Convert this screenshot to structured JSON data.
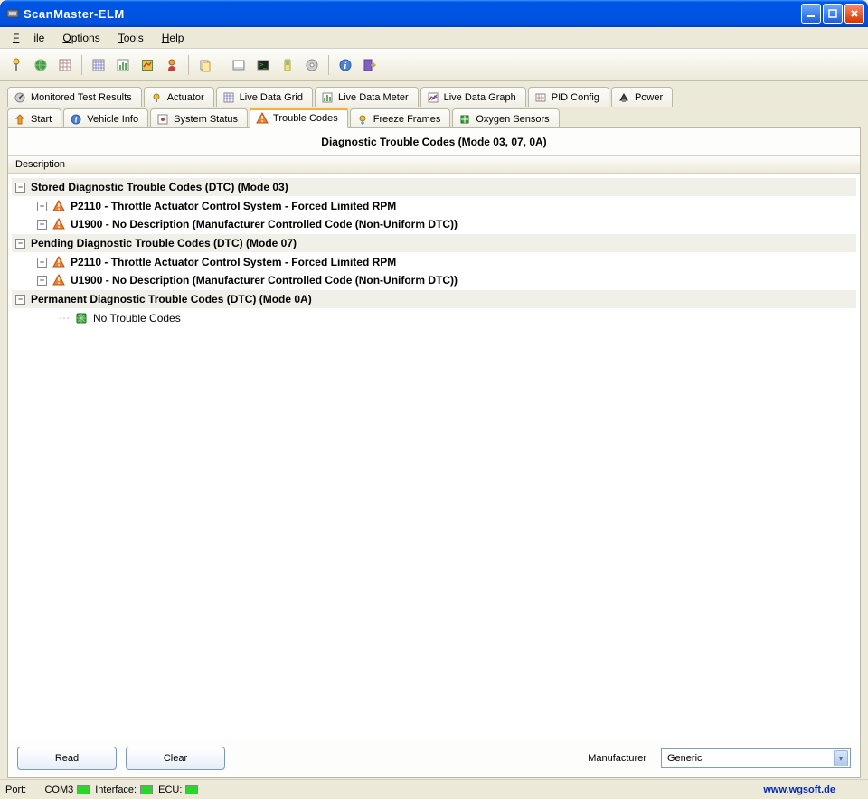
{
  "window": {
    "title": "ScanMaster-ELM"
  },
  "menu": {
    "file": "File",
    "options": "Options",
    "tools": "Tools",
    "help": "Help"
  },
  "tabs_top": [
    {
      "label": "Monitored Test Results",
      "icon": "gauge"
    },
    {
      "label": "Actuator",
      "icon": "actuator"
    },
    {
      "label": "Live Data Grid",
      "icon": "grid"
    },
    {
      "label": "Live Data Meter",
      "icon": "meter"
    },
    {
      "label": "Live Data Graph",
      "icon": "graph"
    },
    {
      "label": "PID Config",
      "icon": "pid"
    },
    {
      "label": "Power",
      "icon": "power"
    }
  ],
  "tabs_bottom": [
    {
      "label": "Start",
      "icon": "start"
    },
    {
      "label": "Vehicle Info",
      "icon": "info"
    },
    {
      "label": "System Status",
      "icon": "system"
    },
    {
      "label": "Trouble Codes",
      "icon": "warning",
      "active": true
    },
    {
      "label": "Freeze Frames",
      "icon": "freeze"
    },
    {
      "label": "Oxygen Sensors",
      "icon": "oxygen"
    }
  ],
  "panel": {
    "title": "Diagnostic Trouble Codes (Mode 03, 07, 0A)",
    "column": "Description",
    "groups": [
      {
        "label": "Stored Diagnostic Trouble Codes (DTC) (Mode 03)",
        "expanded": true,
        "items": [
          {
            "label": "P2110 - Throttle Actuator Control System - Forced Limited RPM",
            "icon": "warning"
          },
          {
            "label": "U1900 - No Description (Manufacturer Controlled Code (Non-Uniform DTC))",
            "icon": "warning"
          }
        ]
      },
      {
        "label": "Pending Diagnostic Trouble Codes (DTC) (Mode 07)",
        "expanded": true,
        "items": [
          {
            "label": "P2110 - Throttle Actuator Control System - Forced Limited RPM",
            "icon": "warning"
          },
          {
            "label": "U1900 - No Description (Manufacturer Controlled Code (Non-Uniform DTC))",
            "icon": "warning"
          }
        ]
      },
      {
        "label": "Permanent Diagnostic Trouble Codes (DTC) (Mode 0A)",
        "expanded": true,
        "items": [
          {
            "label": "No Trouble Codes",
            "icon": "ok",
            "leaf": true
          }
        ]
      }
    ]
  },
  "buttons": {
    "read": "Read",
    "clear": "Clear"
  },
  "manufacturer": {
    "label": "Manufacturer",
    "value": "Generic"
  },
  "status": {
    "port_label": "Port:",
    "port_value": "COM3",
    "interface": "Interface:",
    "ecu": "ECU:",
    "link": "www.wgsoft.de"
  }
}
